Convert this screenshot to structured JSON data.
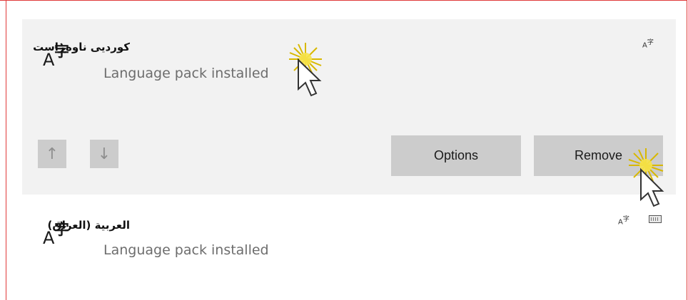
{
  "languages": [
    {
      "name": "کوردیی ناوەڕاست",
      "status": "Language pack installed",
      "icon": "language-icon",
      "selected": true,
      "features": [
        "language-pack-icon"
      ]
    },
    {
      "name": "العربية (العراق)",
      "status": "Language pack installed",
      "icon": "language-icon",
      "selected": false,
      "features": [
        "language-pack-icon",
        "keyboard-icon"
      ]
    }
  ],
  "icon_glyphs": {
    "a": "A",
    "zi": "字"
  },
  "actions": {
    "move_up": "↑",
    "move_down": "↓",
    "options_label": "Options",
    "remove_label": "Remove"
  },
  "colors": {
    "selected_bg": "#f2f2f2",
    "button_bg": "#cccccc",
    "frame_border": "#e03a3a",
    "status_text": "#6d6d6d"
  }
}
